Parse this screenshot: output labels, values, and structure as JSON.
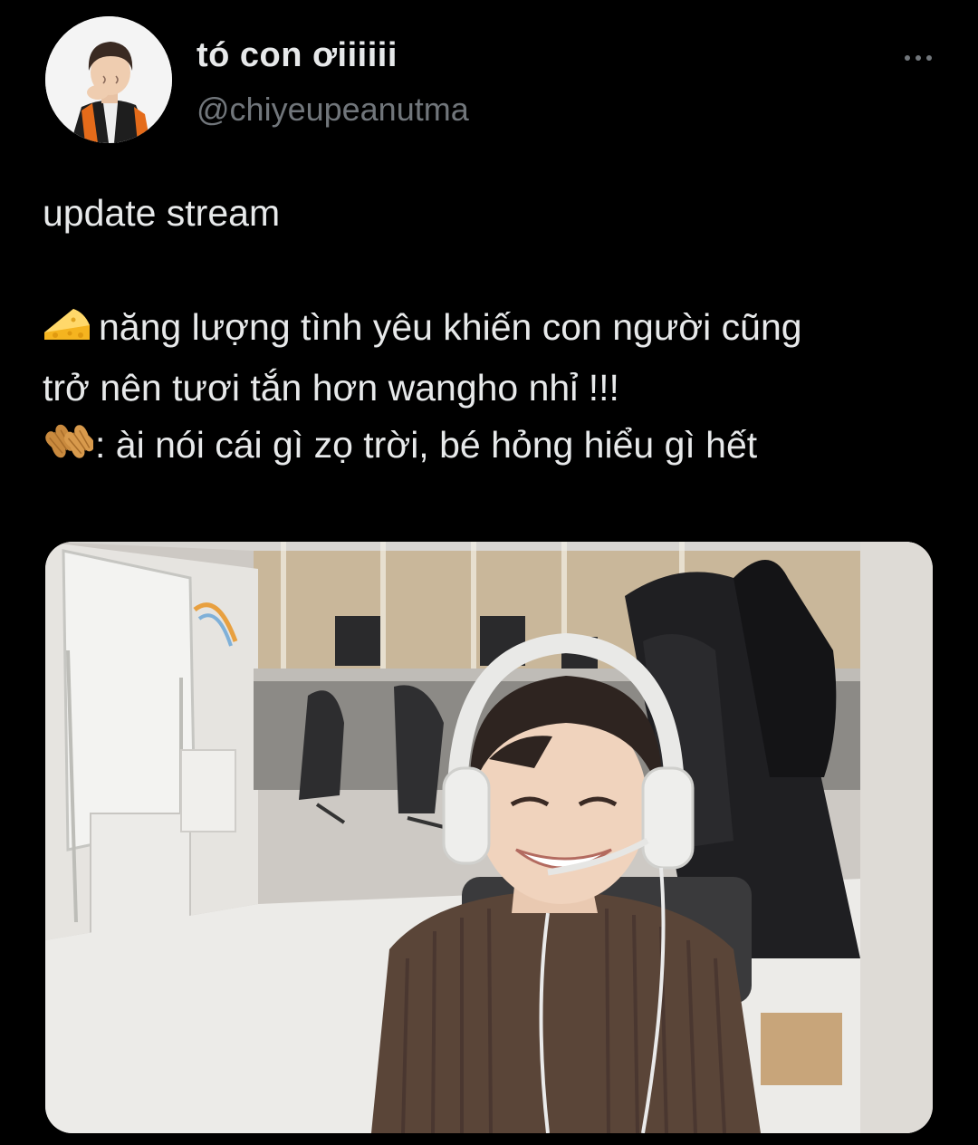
{
  "author": {
    "display_name": "tó con ơiiiiii",
    "handle": "@chiyeupeanutma",
    "avatar_icon": "profile-photo"
  },
  "menu": {
    "icon": "more-horizontal-icon"
  },
  "tweet": {
    "line1": "update stream",
    "cheese_emoji": "cheese-emoji",
    "line2": "năng lượng tình yêu khiến con người cũng",
    "line3": "trở nên tươi tắn hơn wangho nhỉ !!!",
    "peanut_emoji": "peanut-emoji",
    "line4": ": ài nói cái gì zọ trời, bé hỏng hiểu gì hết"
  },
  "media": {
    "type": "photo"
  },
  "colors": {
    "background": "#000000",
    "text_primary": "#e7e9ea",
    "text_secondary": "#71767b"
  }
}
